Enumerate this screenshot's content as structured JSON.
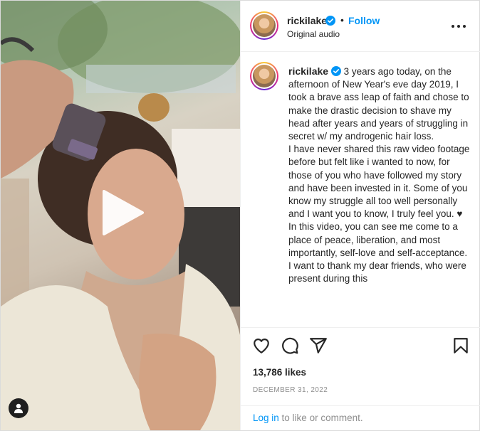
{
  "header": {
    "username": "rickilake",
    "separator": "•",
    "follow_label": "Follow",
    "audio_label": "Original audio"
  },
  "caption": {
    "username": "rickilake",
    "text": " 3 years ago today, on the afternoon of New Year's eve day 2019, I took a brave ass leap of faith and chose to make the drastic decision to shave my head after years and years of struggling in secret w/ my androgenic hair loss.\nI have never shared this raw video footage before but felt like i wanted to now, for those of you who have followed my story and have been invested in it. Some of you know my struggle all too well personally and I want you to know, I truly feel you. ♥ In this video, you can see me come to a place of peace, liberation, and most importantly, self-love and self-acceptance.\nI want to thank my dear friends, who were present during this"
  },
  "engagement": {
    "likes": "13,786 likes",
    "date": "DECEMBER 31, 2022"
  },
  "footer": {
    "login_label": "Log in",
    "login_suffix": " to like or comment."
  },
  "icons": {
    "like": "heart-icon",
    "comment": "comment-icon",
    "share": "share-icon",
    "save": "bookmark-icon",
    "play": "play-icon",
    "user_tag": "user-icon",
    "verified": "verified-badge-icon",
    "more": "more-options-icon"
  },
  "colors": {
    "link": "#0095f6",
    "verified": "#0095f6",
    "text": "#262626",
    "muted": "#8e8e8e"
  }
}
